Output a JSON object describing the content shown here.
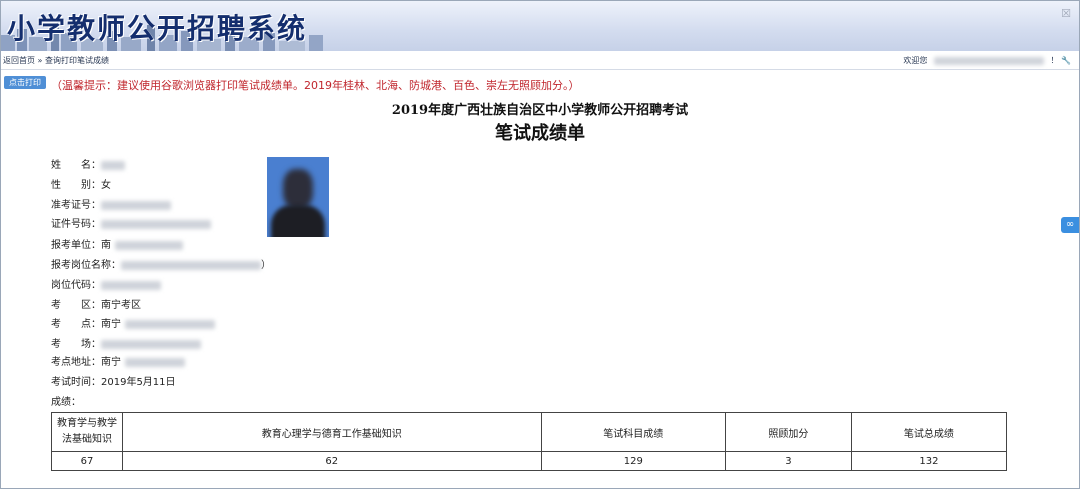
{
  "window": {
    "system_title": "小学教师公开招聘系统",
    "close_glyph": "☒"
  },
  "navbar": {
    "breadcrumb": "返回首页 » 查询打印笔试成绩",
    "welcome": "欢迎您",
    "suffix": "！",
    "logout_glyph": "🔧"
  },
  "toolbar": {
    "print_label": "点击打印",
    "tip": "（温馨提示：建议使用谷歌浏览器打印笔试成绩单。2019年桂林、北海、防城港、百色、崇左无照顾加分。）"
  },
  "document": {
    "exam_title": "2019年度广西壮族自治区中小学教师公开招聘考试",
    "doc_title": "笔试成绩单",
    "fields": [
      {
        "label": "姓　　名：",
        "value": ""
      },
      {
        "label": "性　　别：",
        "value": "女"
      },
      {
        "label": "准考证号：",
        "value": ""
      },
      {
        "label": "证件号码：",
        "value": ""
      },
      {
        "label": "报考单位：",
        "value": "南"
      },
      {
        "label": "报考岗位名称：",
        "value": "）"
      },
      {
        "label": "岗位代码：",
        "value": ""
      },
      {
        "label": "考　　区：",
        "value": "南宁考区"
      },
      {
        "label": "考　　点：",
        "value": "南宁"
      },
      {
        "label": "考　　场：",
        "value": ""
      },
      {
        "label": "考点地址：",
        "value": "南宁"
      },
      {
        "label": "考试时间：",
        "value": "2019年5月11日"
      },
      {
        "label": "成绩：",
        "value": ""
      }
    ],
    "score_table": {
      "headers": [
        "教育学与教学法基础知识",
        "教育心理学与德育工作基础知识",
        "笔试科目成绩",
        "照顾加分",
        "笔试总成绩"
      ],
      "values": [
        "67",
        "62",
        "129",
        "3",
        "132"
      ]
    }
  },
  "side_widget": {
    "icon": "∞"
  }
}
